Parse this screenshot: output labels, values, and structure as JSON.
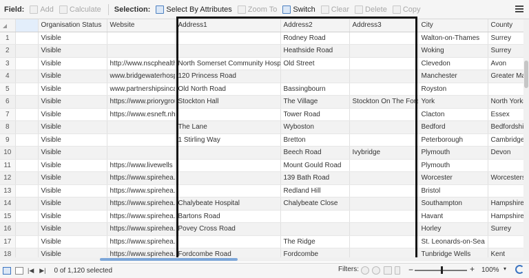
{
  "toolbar": {
    "field_label": "Field:",
    "add_label": "Add",
    "calculate_label": "Calculate",
    "selection_label": "Selection:",
    "select_by_attributes_label": "Select By Attributes",
    "zoom_to_label": "Zoom To",
    "switch_label": "Switch",
    "clear_label": "Clear",
    "delete_label": "Delete",
    "copy_label": "Copy"
  },
  "table": {
    "columns": [
      "Organisation Status",
      "Website",
      "Address1",
      "Address2",
      "Address3",
      "City",
      "County"
    ],
    "rows": [
      {
        "n": "1",
        "c": [
          "Visible",
          "",
          "",
          "Rodney Road",
          "",
          "Walton-on-Thames",
          "Surrey"
        ]
      },
      {
        "n": "2",
        "c": [
          "Visible",
          "",
          "",
          "Heathside Road",
          "",
          "Woking",
          "Surrey"
        ]
      },
      {
        "n": "3",
        "c": [
          "Visible",
          "http://www.nscphealth",
          "North Somerset Community Hospital",
          "Old Street",
          "",
          "Clevedon",
          "Avon"
        ]
      },
      {
        "n": "4",
        "c": [
          "Visible",
          "www.bridgewaterhospi",
          "120 Princess Road",
          "",
          "",
          "Manchester",
          "Greater Ma"
        ]
      },
      {
        "n": "5",
        "c": [
          "Visible",
          "www.partnershipsincar",
          "Old North Road",
          "Bassingbourn",
          "",
          "Royston",
          ""
        ]
      },
      {
        "n": "6",
        "c": [
          "Visible",
          "https://www.priorygrou",
          "Stockton Hall",
          "The Village",
          "Stockton On The Forest",
          "York",
          "North Yorks"
        ]
      },
      {
        "n": "7",
        "c": [
          "Visible",
          "https://www.esneft.nhs",
          "",
          "Tower Road",
          "",
          "Clacton",
          "Essex"
        ]
      },
      {
        "n": "8",
        "c": [
          "Visible",
          "",
          "The Lane",
          "Wyboston",
          "",
          "Bedford",
          "Bedfordshir"
        ]
      },
      {
        "n": "9",
        "c": [
          "Visible",
          "",
          "1 Stirling Way",
          "Bretton",
          "",
          "Peterborough",
          "Cambridge"
        ]
      },
      {
        "n": "10",
        "c": [
          "Visible",
          "",
          "",
          "Beech Road",
          "Ivybridge",
          "Plymouth",
          "Devon"
        ]
      },
      {
        "n": "11",
        "c": [
          "Visible",
          "https://www.livewells",
          "",
          "Mount Gould Road",
          "",
          "Plymouth",
          ""
        ]
      },
      {
        "n": "12",
        "c": [
          "Visible",
          "https://www.spirehea...",
          "",
          "139 Bath Road",
          "",
          "Worcester",
          "Worcestersl"
        ]
      },
      {
        "n": "13",
        "c": [
          "Visible",
          "https://www.spirehea...",
          "",
          "Redland Hill",
          "",
          "Bristol",
          ""
        ]
      },
      {
        "n": "14",
        "c": [
          "Visible",
          "https://www.spirehea...",
          "Chalybeate Hospital",
          "Chalybeate Close",
          "",
          "Southampton",
          "Hampshire"
        ]
      },
      {
        "n": "15",
        "c": [
          "Visible",
          "https://www.spirehea...",
          "Bartons Road",
          "",
          "",
          "Havant",
          "Hampshire"
        ]
      },
      {
        "n": "16",
        "c": [
          "Visible",
          "https://www.spirehea...",
          "Povey Cross Road",
          "",
          "",
          "Horley",
          "Surrey"
        ]
      },
      {
        "n": "17",
        "c": [
          "Visible",
          "https://www.spirehea...",
          "",
          "The Ridge",
          "",
          "St. Leonards-on-Sea",
          ""
        ]
      },
      {
        "n": "18",
        "c": [
          "Visible",
          "https://www.spirehea...",
          "Fordcombe Road",
          "Fordcombe",
          "",
          "Tunbridge Wells",
          "Kent"
        ]
      }
    ]
  },
  "status": {
    "selected_text": "0 of 1,120 selected",
    "filters_label": "Filters:",
    "zoom_value": "100%",
    "zoom_minus": "−",
    "zoom_plus": "+",
    "zoom_dropdown": "▾"
  }
}
